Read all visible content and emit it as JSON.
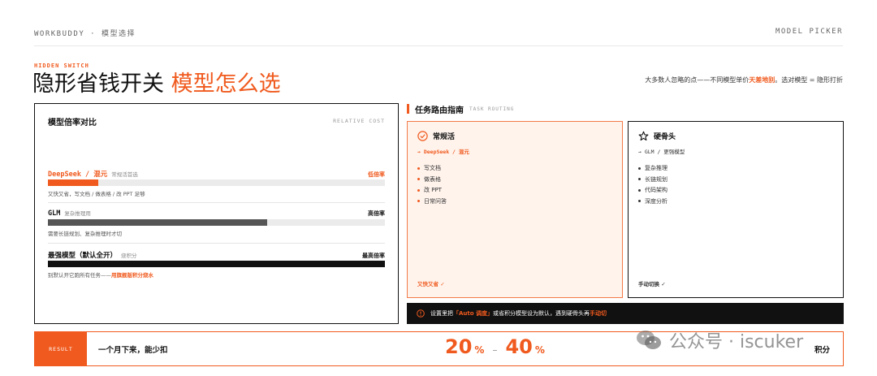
{
  "header": {
    "left": "WORKBUDDY · 模型选择",
    "right": "MODEL PICKER"
  },
  "hero": {
    "eyebrow": "HIDDEN SWITCH",
    "title_main": "隐形省钱开关 ",
    "title_accent": "模型怎么选",
    "note_pre": "大多数人忽略的点——不同模型单价",
    "note_bold": "天差地别",
    "note_post": "。选对模型 = 隐形打折"
  },
  "cost_card": {
    "title": "模型倍率对比",
    "subtitle": "RELATIVE COST",
    "rows": [
      {
        "name": "DeepSeek / 混元",
        "tag": "常规活首选",
        "rate": "低倍率",
        "desc": "又快又省，写文档 / 做表格 / 改 PPT 足够",
        "desc_bold": "",
        "bar_fraction": 0.15,
        "color": "#f05a1e"
      },
      {
        "name": "GLM",
        "tag": "复杂推理用",
        "rate": "高倍率",
        "desc": "需要长链规划、复杂推理时才切",
        "desc_bold": "",
        "bar_fraction": 0.65,
        "color": "#555555"
      },
      {
        "name": "最强模型（默认全开）",
        "tag": "烧积分",
        "rate": "最高倍率",
        "desc": "别默认开它跑所有任务——",
        "desc_bold": "用旗舰版积分烧水",
        "bar_fraction": 1.0,
        "color": "#111111"
      }
    ]
  },
  "routing": {
    "title": "任务路由指南",
    "subtitle": "TASK ROUTING",
    "cards": [
      {
        "title": "常规活",
        "icon": "check-circle-icon",
        "target": "→ DeepSeek / 混元",
        "items": [
          "写文档",
          "做表格",
          "改 PPT",
          "日常问答"
        ],
        "footer": "又快又省 ✓"
      },
      {
        "title": "硬骨头",
        "icon": "star-icon",
        "target": "→ GLM / 更强模型",
        "items": [
          "复杂推理",
          "长链规划",
          "代码架构",
          "深度分析"
        ],
        "footer": "手动切换 ✓"
      }
    ],
    "tip_pre": "设置里把",
    "tip_bold1": "「Auto 调度」",
    "tip_mid": "或省积分模型设为默认，遇到硬骨头再",
    "tip_bold2": "手动切"
  },
  "result": {
    "tag": "RESULT",
    "text": "一个月下来，能少扣",
    "low": "20",
    "high": "40",
    "pct": "%",
    "dash": "–",
    "unit": "积分"
  },
  "watermark": {
    "text": "公众号 · iscuker"
  },
  "colors": {
    "accent": "#f05a1e",
    "dark": "#111111",
    "light_accent_bg": "#fff3ec"
  }
}
